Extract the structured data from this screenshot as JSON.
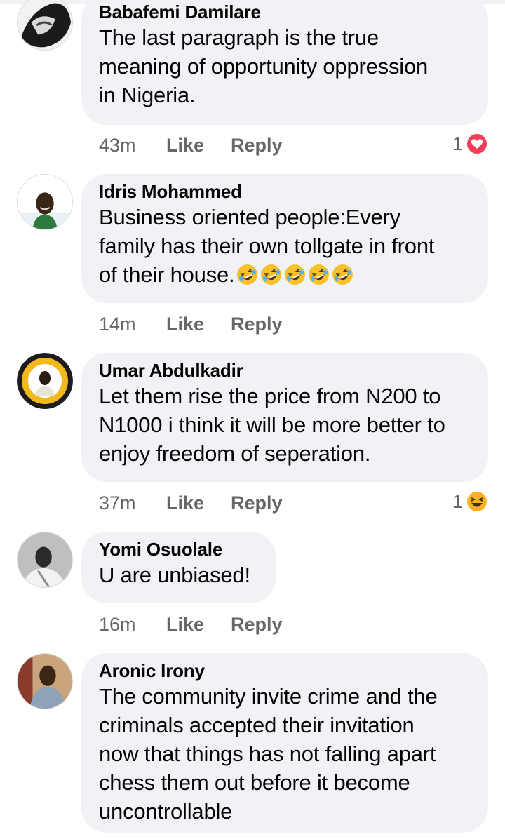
{
  "comments": [
    {
      "author": "Babafemi Damilare",
      "text": "The last paragraph is the true\nmeaning of opportunity oppression\nin Nigeria.",
      "time": "43m",
      "like": "Like",
      "reply": "Reply",
      "reaction_count": "1",
      "reaction_icon": "love-heart-icon",
      "avatar_icon": "profile-photo"
    },
    {
      "author": "Idris Mohammed",
      "text": "Business oriented people:Every\nfamily has their own tollgate in front\nof their house.",
      "emoji_count": 5,
      "emoji_icon": "rolling-on-floor-laughing-emoji",
      "time": "14m",
      "like": "Like",
      "reply": "Reply",
      "avatar_icon": "profile-photo"
    },
    {
      "author": "Umar Abdulkadir",
      "text": "Let them rise the price from N200 to\nN1000 i think it will be more better to\nenjoy freedom of seperation.",
      "time": "37m",
      "like": "Like",
      "reply": "Reply",
      "reaction_count": "1",
      "reaction_icon": "haha-laugh-icon",
      "avatar_icon": "profile-photo-badge"
    },
    {
      "author": "Yomi Osuolale",
      "text": "U are unbiased!",
      "time": "16m",
      "like": "Like",
      "reply": "Reply",
      "avatar_icon": "profile-photo"
    },
    {
      "author": "Aronic Irony",
      "text": "The community invite crime and the\ncriminals accepted their invitation\nnow that things has not falling apart\nchess them out before it become\nuncontrollable",
      "avatar_icon": "profile-photo"
    }
  ],
  "colors": {
    "bubble": "#f0f2f5",
    "meta_text": "#65676b",
    "love_red": "#f33e58",
    "haha_yellow": "#f7b125"
  }
}
